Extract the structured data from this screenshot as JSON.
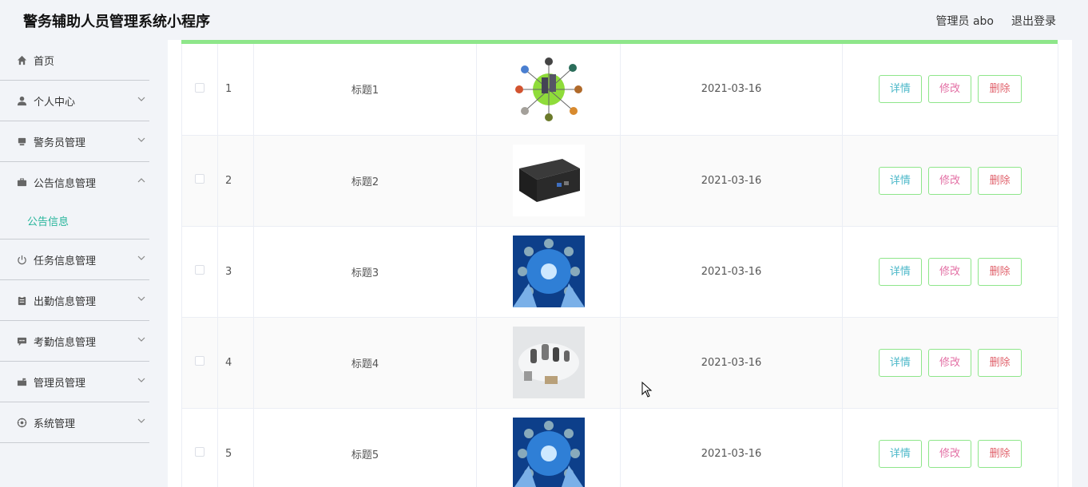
{
  "header": {
    "title": "警务辅助人员管理系统小程序",
    "user": "管理员 abo",
    "logout": "退出登录"
  },
  "sidebar": {
    "items": [
      {
        "label": "首页",
        "icon": "home-icon"
      },
      {
        "label": "个人中心",
        "icon": "user-icon"
      },
      {
        "label": "警务员管理",
        "icon": "monitor-icon"
      },
      {
        "label": "公告信息管理",
        "icon": "briefcase-icon",
        "expanded": true,
        "children": [
          {
            "label": "公告信息",
            "active": true
          }
        ]
      },
      {
        "label": "任务信息管理",
        "icon": "power-icon"
      },
      {
        "label": "出勤信息管理",
        "icon": "clipboard-icon"
      },
      {
        "label": "考勤信息管理",
        "icon": "chat-icon"
      },
      {
        "label": "管理员管理",
        "icon": "mailbox-icon"
      },
      {
        "label": "系统管理",
        "icon": "settings-icon"
      }
    ]
  },
  "table": {
    "rows": [
      {
        "index": "1",
        "title": "标题1",
        "date": "2021-03-16",
        "image": "network-diagram-image"
      },
      {
        "index": "2",
        "title": "标题2",
        "date": "2021-03-16",
        "image": "black-device-image"
      },
      {
        "index": "3",
        "title": "标题3",
        "date": "2021-03-16",
        "image": "blue-network-image"
      },
      {
        "index": "4",
        "title": "标题4",
        "date": "2021-03-16",
        "image": "security-devices-image"
      },
      {
        "index": "5",
        "title": "标题5",
        "date": "2021-03-16",
        "image": "blue-network-image"
      }
    ],
    "actions": {
      "detail": "详情",
      "edit": "修改",
      "delete": "删除"
    }
  },
  "colors": {
    "accent": "#27b59b",
    "header_bar": "#8ee68a",
    "detail": "#4cb8c9",
    "edit": "#e36fa4",
    "delete": "#e0626c"
  }
}
